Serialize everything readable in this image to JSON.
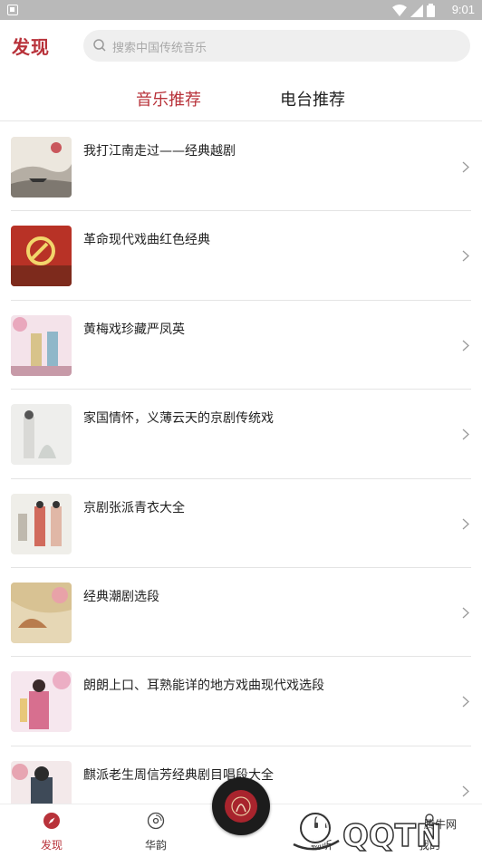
{
  "status_bar": {
    "time": "9:01"
  },
  "header": {
    "title": "发现",
    "search_placeholder": "搜索中国传统音乐"
  },
  "tabs": [
    {
      "label": "音乐推荐",
      "active": true
    },
    {
      "label": "电台推荐",
      "active": false
    }
  ],
  "playlists": [
    {
      "title": "我打江南走过——经典越剧",
      "thumb": "ink-landscape"
    },
    {
      "title": "革命现代戏曲红色经典",
      "thumb": "red-emblem"
    },
    {
      "title": "黄梅戏珍藏严凤英",
      "thumb": "opera-couple-pink"
    },
    {
      "title": "家国情怀，义薄云天的京剧传统戏",
      "thumb": "opera-lady-grey"
    },
    {
      "title": "京剧张派青衣大全",
      "thumb": "opera-pair"
    },
    {
      "title": "经典潮剧选段",
      "thumb": "blossom-fan"
    },
    {
      "title": "朗朗上口、耳熟能详的地方戏曲现代戏选段",
      "thumb": "opera-performer"
    },
    {
      "title": "麒派老生周信芳经典剧目唱段大全",
      "thumb": "opera-warrior"
    }
  ],
  "bottom_nav": [
    {
      "label": "发现",
      "icon": "compass-icon",
      "active": true
    },
    {
      "label": "华韵",
      "icon": "disc-icon",
      "active": false
    },
    {
      "label": "",
      "icon": "player-disc-icon",
      "active": false
    },
    {
      "label": "畅听",
      "icon": "headphone-icon",
      "active": false
    },
    {
      "label": "我的",
      "icon": "user-icon",
      "active": false
    }
  ],
  "watermark": {
    "text": "QQTN",
    "subtext": "腾牛网"
  },
  "colors": {
    "accent": "#b8323a",
    "divider": "#e4e4e4",
    "search_bg": "#efefef"
  }
}
